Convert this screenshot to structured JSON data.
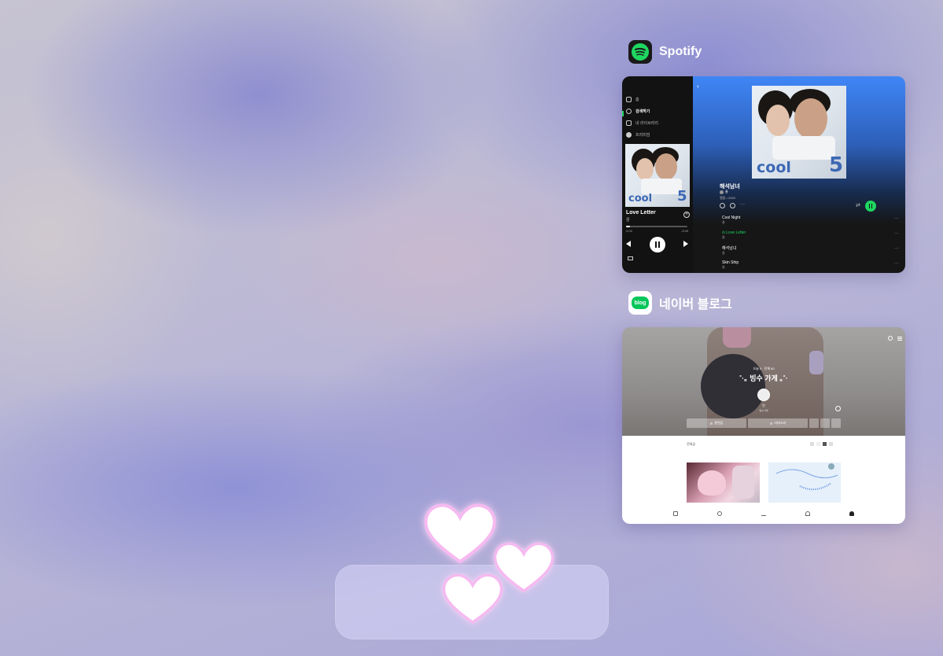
{
  "spotify": {
    "app_name": "Spotify",
    "sidebar": {
      "nav": [
        {
          "label": "홈",
          "icon": "home-icon"
        },
        {
          "label": "검색하기",
          "icon": "search-icon"
        },
        {
          "label": "내 라이브러리",
          "icon": "library-icon"
        },
        {
          "label": "프리미엄",
          "icon": "spotify-icon"
        }
      ],
      "now_playing": {
        "cover_text": "cool",
        "cover_number": "5",
        "title": "Love Letter",
        "artist": "쿨",
        "elapsed": "0:03",
        "duration": "-3:39",
        "progress": 0.06
      }
    },
    "album": {
      "cover_text": "cool",
      "cover_number": "5",
      "title": "해석남녀",
      "artist": "쿨",
      "meta": "앨범 • 2000",
      "tracks": [
        {
          "title": "Cool Night",
          "artist": "쿨",
          "playing": false
        },
        {
          "title": "Love Letter",
          "artist": "쿨",
          "playing": true
        },
        {
          "title": "해석남녀",
          "artist": "쿨",
          "playing": false
        },
        {
          "title": "Skin Ship",
          "artist": "쿨",
          "playing": false
        }
      ],
      "more": "···"
    }
  },
  "naver_blog": {
    "app_name": "네이버 블로그",
    "icon_text": "blog",
    "hero": {
      "stats": "오늘 0 · 전체 60",
      "title": "빙수 가게",
      "nickname": "빈",
      "sub": "빙수가게",
      "btn_profile": "홈편집",
      "btn_category": "카테고리"
    },
    "body": {
      "section": "전체글"
    }
  },
  "colors": {
    "spotify_green": "#1ed760",
    "naver_green": "#03c75a"
  }
}
